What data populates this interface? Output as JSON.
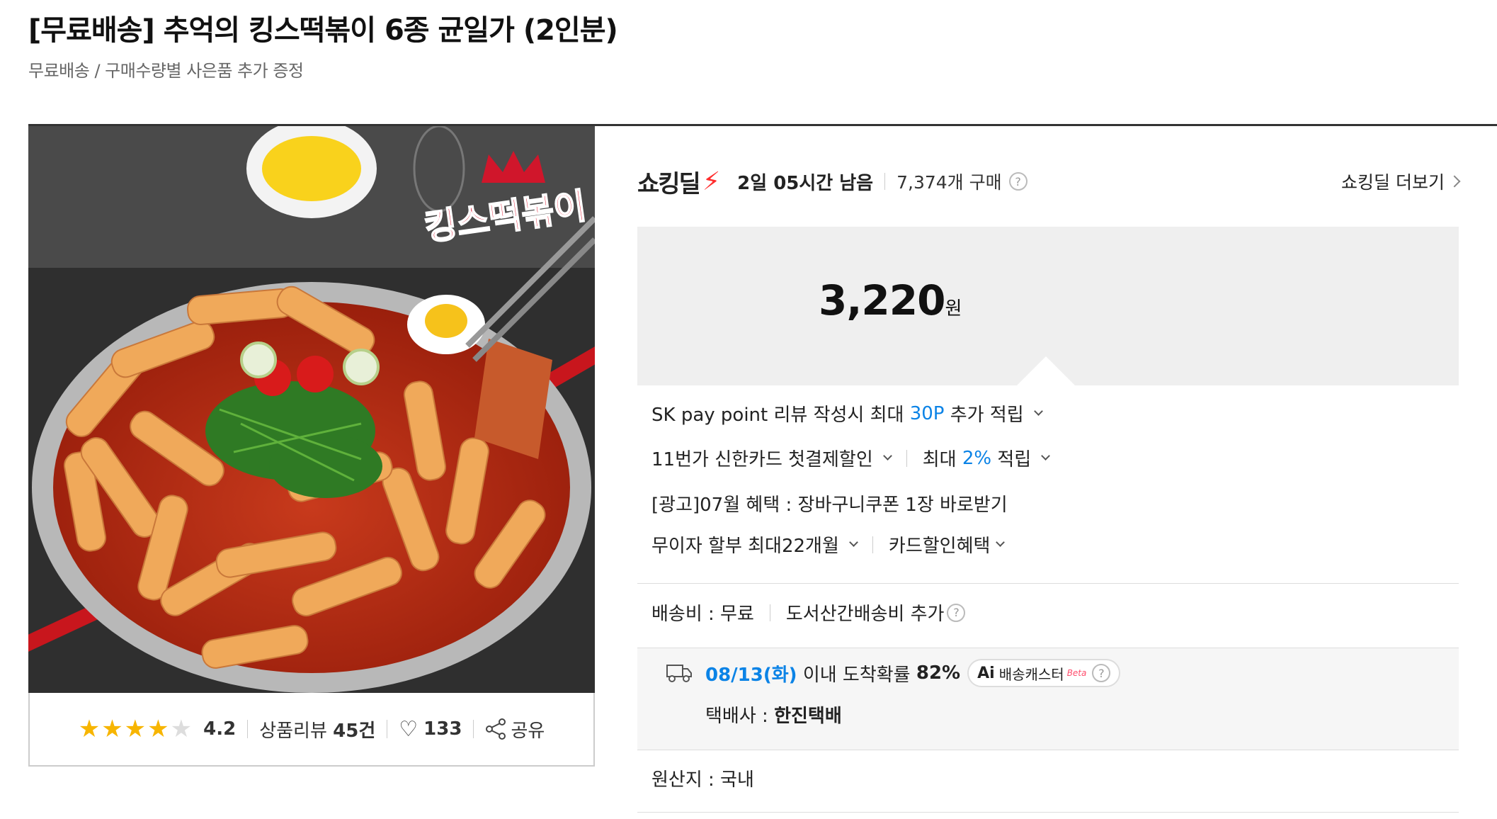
{
  "product": {
    "title": "[무료배송] 추억의 킹스떡볶이 6종 균일가 (2인분)",
    "subtitle": "무료배송 / 구매수량별 사은품 추가 증정"
  },
  "image": {
    "brand_overlay": "킹스떡볶이"
  },
  "review": {
    "stars": 4.2,
    "rating": "4.2",
    "review_label": "상품리뷰",
    "review_count": "45건",
    "likes": "133",
    "share_label": "공유"
  },
  "deal": {
    "logo_text": "쇼킹딜",
    "time_left": "2일 05시간 남음",
    "sold": "7,374개 구매",
    "more_label": "쇼킹딜 더보기"
  },
  "price": {
    "amount": "3,220",
    "unit": "원"
  },
  "benefits": {
    "sk_pre": "SK pay point 리뷰 작성시 최대",
    "sk_point": "30P",
    "sk_post": "추가 적립",
    "card_label": "11번가 신한카드 첫결제할인",
    "max_pre": "최대",
    "max_pct": "2%",
    "max_post": "적립",
    "ad_text": "[광고]07월 혜택 : 장바구니쿠폰 1장 바로받기",
    "installment": "무이자 할부 최대22개월",
    "card_discount": "카드할인혜택"
  },
  "shipping": {
    "fee": "배송비 : 무료",
    "island_fee": "도서산간배송비 추가",
    "arrival_date": "08/13(화)",
    "arrival_text": "이내 도착확률",
    "arrival_pct": "82%",
    "ai_label": "Ai",
    "caster_label": "배송캐스터",
    "beta": "Beta",
    "courier_label": "택배사 :",
    "courier_name": "한진택배"
  },
  "origin": {
    "text": "원산지 : 국내"
  },
  "colors": {
    "accent_blue": "#0b83e6",
    "deal_red": "#ff2d2d",
    "star_gold": "#f7b500"
  }
}
